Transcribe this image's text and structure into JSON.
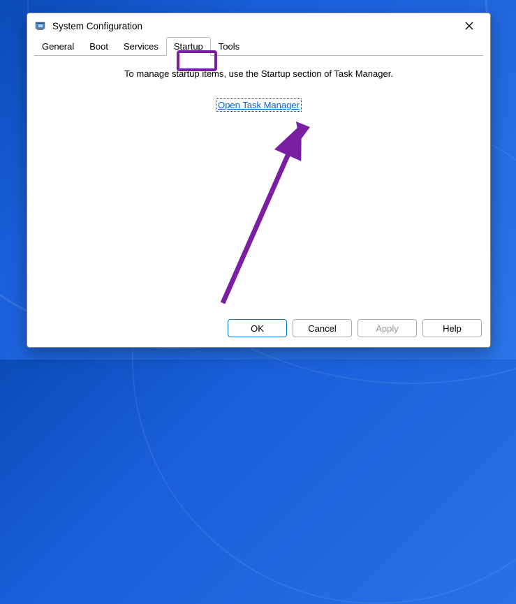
{
  "dialog": {
    "title": "System Configuration"
  },
  "tabs": {
    "general": "General",
    "boot": "Boot",
    "services": "Services",
    "startup": "Startup",
    "tools": "Tools"
  },
  "content": {
    "info_text": "To manage startup items, use the Startup section of Task Manager.",
    "link_text": "Open Task Manager"
  },
  "buttons": {
    "ok": "OK",
    "cancel": "Cancel",
    "apply": "Apply",
    "help": "Help"
  },
  "annotation": {
    "highlight_color": "#7a1fa2",
    "arrow_color": "#7a1fa2"
  }
}
